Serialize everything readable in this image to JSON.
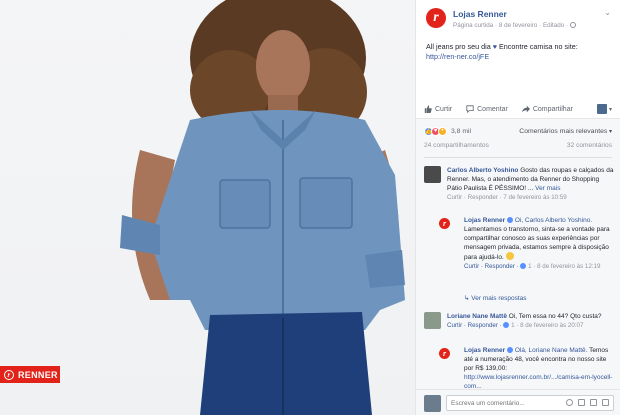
{
  "photo": {
    "brand_badge": "RENNER"
  },
  "post": {
    "page_name": "Lojas Renner",
    "meta": "Página curtida · 8 de fevereiro · Editado ·",
    "text_part1": "All jeans pro seu dia ",
    "text_part2": " Encontre camisa no site:",
    "link": "http://ren-ner.co/jFE",
    "actions": {
      "like": "Curtir",
      "comment": "Comentar",
      "share": "Compartilhar"
    },
    "reaction_count": "3,8 mil",
    "comment_sort": "Comentários mais relevantes",
    "shares": "24 compartilhamentos",
    "comments_count": "32 comentários"
  },
  "comments": [
    {
      "name": "Carlos Alberto Yoshino",
      "text": "Gosto das roupas e calçados da Renner. Mas, o atendimento da Renner do Shopping Pátio Paulista É PÉSSIMO! ...",
      "more": "Ver mais",
      "meta_reply": "Curtir · Responder · 7 de fevereiro às 10:59"
    },
    {
      "name": "Loriane Nane Mattê",
      "text": "Oi, Tem essa no 44? Qto custa?",
      "meta_reply": "Curtir · Responder ·",
      "meta_time": "1 · 8 de fevereiro às 20:07"
    }
  ],
  "replies": [
    {
      "name": "Lojas Renner",
      "mention": "Oi, Carlos Alberto Yoshino.",
      "text": "Lamentamos o transtorno, sinta-se a vontade para compartilhar conosco as suas experiências por mensagem privada, estamos sempre à disposição para ajudá-lo.",
      "meta_reply": "Curtir · Responder ·",
      "meta_time": "1 · 8 de fevereiro às 12:19"
    },
    {
      "name": "Lojas Renner",
      "mention": "Olá, Loriane Nane Mattê.",
      "text": "Temos até a numeração 48, você encontra no nosso site por R$ 139,00:",
      "link": "http://www.lojasrenner.com.br/.../camisa-em-lyocell-com..."
    }
  ],
  "more_replies": "Ver mais respostas",
  "composer": {
    "placeholder": "Escreva um comentário..."
  },
  "colors": {
    "brand": "#e2231a",
    "link": "#365899"
  }
}
